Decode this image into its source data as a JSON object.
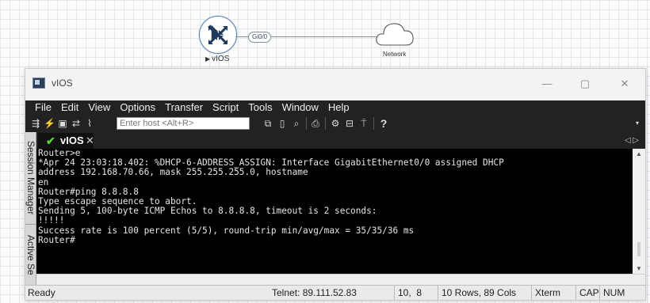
{
  "canvas": {
    "router_label": "vIOS",
    "interface_label": "Gi0/0",
    "network_label": "Network"
  },
  "window": {
    "title": "vIOS",
    "controls": {
      "minimize": "—",
      "maximize": "▢",
      "close": "✕"
    }
  },
  "menu": [
    "File",
    "Edit",
    "View",
    "Options",
    "Transfer",
    "Script",
    "Tools",
    "Window",
    "Help"
  ],
  "toolbar": {
    "host_placeholder": "Enter host <Alt+R>"
  },
  "side_tabs": {
    "session_manager": "Session Manager",
    "active_sessions": "Active Se"
  },
  "session_tab": {
    "label": "vIOS",
    "close": "✕",
    "nav": "◁ ▷"
  },
  "terminal": {
    "lines": [
      "Router>e",
      "*Apr 24 23:03:18.402: %DHCP-6-ADDRESS_ASSIGN: Interface GigabitEthernet0/0 assigned DHCP",
      "address 192.168.70.66, mask 255.255.255.0, hostname",
      "en",
      "Router#ping 8.8.8.8",
      "Type escape sequence to abort.",
      "Sending 5, 100-byte ICMP Echos to 8.8.8.8, timeout is 2 seconds:",
      "!!!!!",
      "Success rate is 100 percent (5/5), round-trip min/avg/max = 35/35/36 ms",
      "Router#"
    ]
  },
  "status": {
    "ready": "Ready",
    "connection": "Telnet: 89.111.52.83",
    "cursor_pos": "10,  8",
    "size": "10 Rows, 89 Cols",
    "emulation": "Xterm",
    "caps": "CAP",
    "num": "NUM"
  },
  "colors": {
    "terminal_bg": "#000000",
    "terminal_fg": "#e6e6e6",
    "menubar_bg": "#222222",
    "tab_check": "#58d438",
    "router_outline": "#5b7fa6"
  }
}
